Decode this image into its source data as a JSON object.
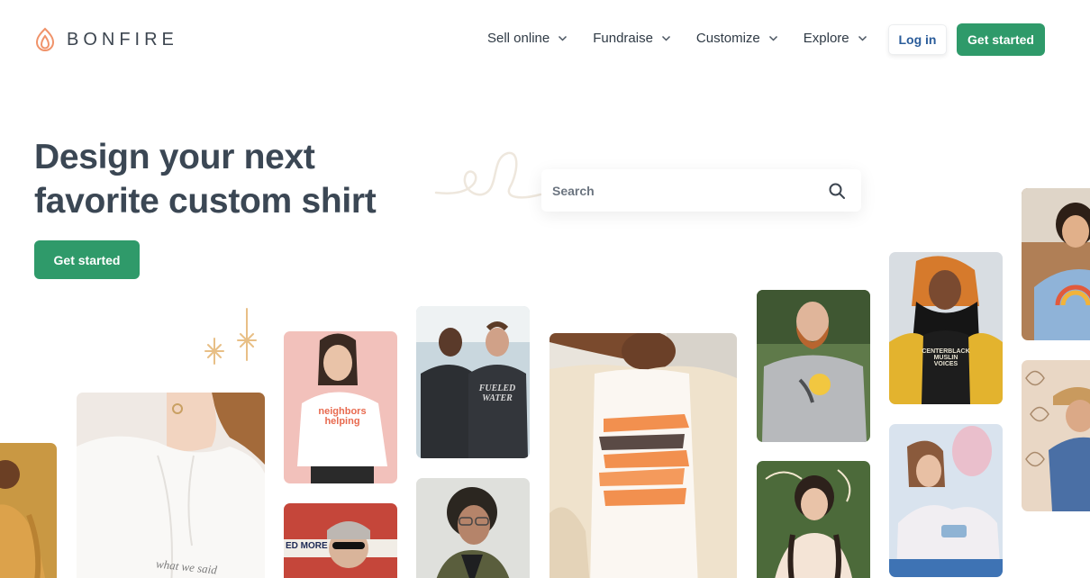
{
  "brand": {
    "name": "BONFIRE",
    "accent": "#2f9a6a",
    "logo_color": "#f0936a"
  },
  "nav": {
    "items": [
      {
        "label": "Sell online"
      },
      {
        "label": "Fundraise"
      },
      {
        "label": "Customize"
      },
      {
        "label": "Explore"
      }
    ],
    "login_label": "Log in",
    "get_started_label": "Get started"
  },
  "hero": {
    "title_line1": "Design your next",
    "title_line2": "favorite custom shirt",
    "cta_label": "Get started"
  },
  "search": {
    "placeholder": "Search"
  },
  "tiles": {
    "hoodie_caption": "what we said",
    "neighbors_text": "neighbors helping",
    "fueled_text": "FUELED WATER",
    "centerblack_text": "CENTERBLACK MUSLIN VOICES",
    "red_more_text": "ED MORE"
  }
}
